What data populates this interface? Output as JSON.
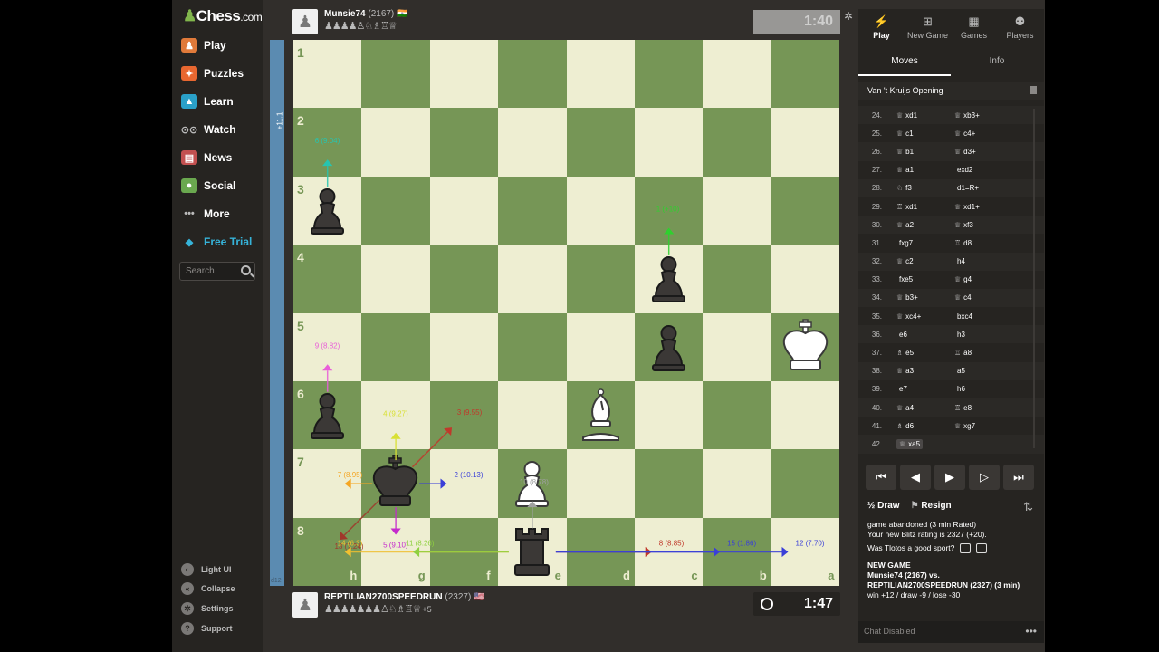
{
  "nav": {
    "logo": "Chess",
    "logo_suffix": ".com",
    "items": [
      {
        "label": "Play",
        "icon": "play-pawn-icon",
        "color": "#e07a3a"
      },
      {
        "label": "Puzzles",
        "icon": "puzzle-icon",
        "color": "#e86730"
      },
      {
        "label": "Learn",
        "icon": "learn-icon",
        "color": "#2aa0c8"
      },
      {
        "label": "Watch",
        "icon": "binoculars-icon",
        "color": "#bbbbbb"
      },
      {
        "label": "News",
        "icon": "news-icon",
        "color": "#c25050"
      },
      {
        "label": "Social",
        "icon": "social-icon",
        "color": "#6aa84f"
      },
      {
        "label": "More",
        "icon": "more-dots-icon",
        "color": "#bbbbbb"
      },
      {
        "label": "Free Trial",
        "icon": "diamond-icon",
        "color": "#36b3d9"
      }
    ],
    "search_placeholder": "Search",
    "bottom": [
      {
        "label": "Light UI",
        "icon": "light-ui-icon"
      },
      {
        "label": "Collapse",
        "icon": "collapse-icon"
      },
      {
        "label": "Settings",
        "icon": "settings-icon"
      },
      {
        "label": "Support",
        "icon": "support-icon"
      }
    ]
  },
  "eval": {
    "top": "+11.1",
    "bottom": "d12"
  },
  "top_player": {
    "name": "Munsie74",
    "rating": "(2167)",
    "flag": "🇮🇳",
    "captured": "♟♟♟♟♙♘♗♖♕",
    "clock": "1:40"
  },
  "bottom_player": {
    "name": "REPTILIAN2700SPEEDRUN",
    "rating": "(2327)",
    "flag": "🇺🇸",
    "captured": "♟♟♟♟♟♟♟♙♘♗♖♕",
    "extra": "+5",
    "clock": "1:47"
  },
  "board": {
    "ranks": [
      "1",
      "2",
      "3",
      "4",
      "5",
      "6",
      "7",
      "8"
    ],
    "files": [
      "h",
      "g",
      "f",
      "e",
      "d",
      "c",
      "b",
      "a"
    ],
    "light": "#eeeed2",
    "dark": "#769656",
    "pieces": [
      {
        "type": "pawn",
        "color": "black",
        "file": "h",
        "rank": 3
      },
      {
        "type": "pawn",
        "color": "black",
        "file": "c",
        "rank": 4
      },
      {
        "type": "pawn",
        "color": "black",
        "file": "c",
        "rank": 5
      },
      {
        "type": "king",
        "color": "white",
        "file": "a",
        "rank": 5
      },
      {
        "type": "pawn",
        "color": "black",
        "file": "h",
        "rank": 6
      },
      {
        "type": "bishop",
        "color": "white",
        "file": "d",
        "rank": 6
      },
      {
        "type": "king",
        "color": "black",
        "file": "g",
        "rank": 7
      },
      {
        "type": "pawn",
        "color": "white",
        "file": "e",
        "rank": 7
      },
      {
        "type": "rook",
        "color": "black",
        "file": "e",
        "rank": 8
      }
    ],
    "arrows": [
      {
        "label": "6 (9.04)",
        "color": "#27c4b0",
        "from": [
          "h",
          3
        ],
        "to": [
          "h",
          2
        ]
      },
      {
        "label": "1 (+10)",
        "color": "#2ed12e",
        "from": [
          "c",
          4
        ],
        "to": [
          "c",
          3
        ]
      },
      {
        "label": "9 (8.82)",
        "color": "#e95ed9",
        "from": [
          "h",
          6
        ],
        "to": [
          "h",
          5
        ]
      },
      {
        "label": "4 (9.27)",
        "color": "#d8e033",
        "from": [
          "g",
          7
        ],
        "to": [
          "g",
          6
        ]
      },
      {
        "label": "3 (9.55)",
        "color": "#c0392b",
        "from": [
          "g",
          7
        ],
        "to": [
          "f",
          6
        ]
      },
      {
        "label": "7 (8.95)",
        "color": "#f5a623",
        "from": [
          "g",
          7
        ],
        "to": [
          "h",
          7
        ]
      },
      {
        "label": "2 (10.13)",
        "color": "#3a3fd8",
        "from": [
          "g",
          7
        ],
        "to": [
          "f",
          7
        ]
      },
      {
        "label": "10 (8.78)",
        "color": "#9fa0a0",
        "from": [
          "e",
          8
        ],
        "to": [
          "e",
          7
        ]
      },
      {
        "label": "13 (7.24)",
        "color": "#a0372b",
        "from": [
          "g",
          7
        ],
        "to": [
          "h",
          8
        ]
      },
      {
        "label": "14 (6.3)",
        "color": "#f0c030",
        "from": [
          "e",
          8
        ],
        "to": [
          "h",
          8
        ]
      },
      {
        "label": "5 (9.10)",
        "color": "#c42bcc",
        "from": [
          "g",
          7
        ],
        "to": [
          "g",
          8
        ]
      },
      {
        "label": "11 (8.26)",
        "color": "#8fd040",
        "from": [
          "e",
          8
        ],
        "to": [
          "g",
          8
        ]
      },
      {
        "label": "8 (8.85)",
        "color": "#c0392b",
        "from": [
          "e",
          8
        ],
        "to": [
          "c",
          8
        ]
      },
      {
        "label": "15 (1.86)",
        "color": "#3a3fd8",
        "from": [
          "e",
          8
        ],
        "to": [
          "b",
          8
        ]
      },
      {
        "label": "12 (7.70)",
        "color": "#3a3fd8",
        "from": [
          "e",
          8
        ],
        "to": [
          "a",
          8
        ]
      }
    ]
  },
  "panel": {
    "tabs": [
      {
        "label": "Play",
        "icon": "lightning-icon"
      },
      {
        "label": "New Game",
        "icon": "plus-square-icon"
      },
      {
        "label": "Games",
        "icon": "board-icon"
      },
      {
        "label": "Players",
        "icon": "players-icon"
      }
    ],
    "subtabs": [
      "Moves",
      "Info"
    ],
    "opening": "Van 't Kruijs Opening",
    "moves": [
      {
        "n": "24.",
        "w": "xd1",
        "wp": "♕",
        "b": "xb3+",
        "bp": "♕"
      },
      {
        "n": "25.",
        "w": "c1",
        "wp": "♕",
        "b": "c4+",
        "bp": "♕"
      },
      {
        "n": "26.",
        "w": "b1",
        "wp": "♕",
        "b": "d3+",
        "bp": "♕"
      },
      {
        "n": "27.",
        "w": "a1",
        "wp": "♕",
        "b": "exd2",
        "bp": ""
      },
      {
        "n": "28.",
        "w": "f3",
        "wp": "♘",
        "b": "d1=R+",
        "bp": ""
      },
      {
        "n": "29.",
        "w": "xd1",
        "wp": "♖",
        "b": "xd1+",
        "bp": "♕"
      },
      {
        "n": "30.",
        "w": "a2",
        "wp": "♕",
        "b": "xf3",
        "bp": "♕"
      },
      {
        "n": "31.",
        "w": "fxg7",
        "wp": "",
        "b": "d8",
        "bp": "♖"
      },
      {
        "n": "32.",
        "w": "c2",
        "wp": "♕",
        "b": "h4",
        "bp": ""
      },
      {
        "n": "33.",
        "w": "fxe5",
        "wp": "",
        "b": "g4",
        "bp": "♕"
      },
      {
        "n": "34.",
        "w": "b3+",
        "wp": "♕",
        "b": "c4",
        "bp": "♕"
      },
      {
        "n": "35.",
        "w": "xc4+",
        "wp": "♕",
        "b": "bxc4",
        "bp": ""
      },
      {
        "n": "36.",
        "w": "e6",
        "wp": "",
        "b": "h3",
        "bp": ""
      },
      {
        "n": "37.",
        "w": "e5",
        "wp": "♗",
        "b": "a8",
        "bp": "♖"
      },
      {
        "n": "38.",
        "w": "a3",
        "wp": "♕",
        "b": "a5",
        "bp": ""
      },
      {
        "n": "39.",
        "w": "e7",
        "wp": "",
        "b": "h6",
        "bp": ""
      },
      {
        "n": "40.",
        "w": "a4",
        "wp": "♕",
        "b": "e8",
        "bp": "♖"
      },
      {
        "n": "41.",
        "w": "d6",
        "wp": "♗",
        "b": "xg7",
        "bp": "♕"
      },
      {
        "n": "42.",
        "w": "xa5",
        "wp": "♕",
        "b": "",
        "bp": ""
      }
    ],
    "draw": "Draw",
    "draw_prefix": "½",
    "resign": "Resign",
    "chat": {
      "line1": "game abandoned (3 min Rated)",
      "line2": "Your new Blitz rating is 2327 (+20).",
      "line3": "Was Tlotos a good sport?",
      "new_game": "NEW GAME",
      "line4": "Munsie74 (2167) vs.",
      "line5": "REPTILIAN2700SPEEDRUN (2327) (3 min)",
      "line6": "win +12 / draw -9 / lose -30"
    },
    "chat_disabled": "Chat Disabled"
  }
}
